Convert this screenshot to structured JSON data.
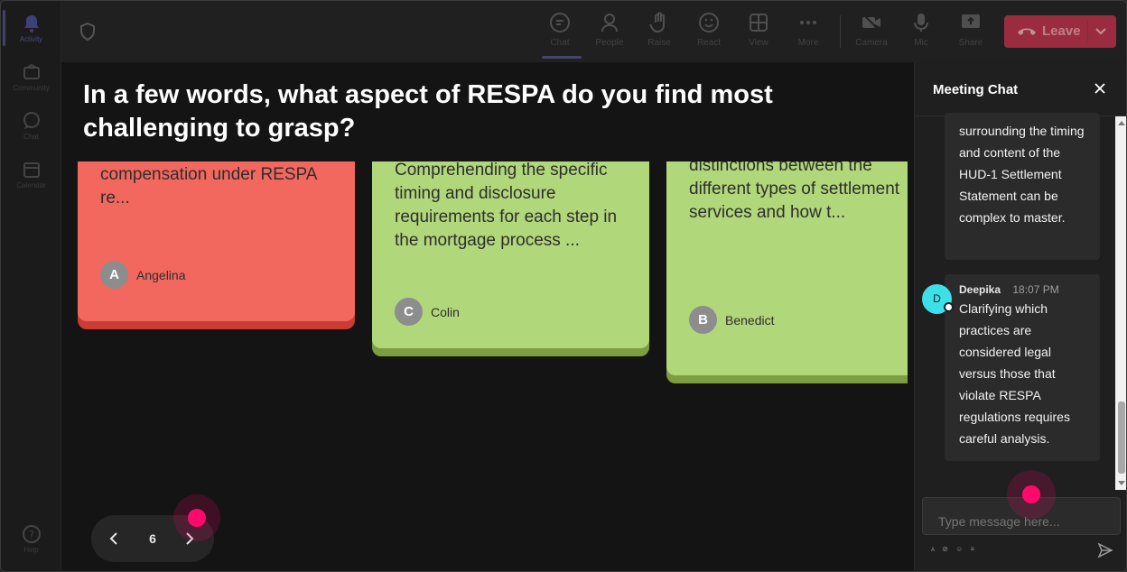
{
  "rail": {
    "items": [
      {
        "label": "Activity"
      },
      {
        "label": "Community"
      },
      {
        "label": "Chat"
      },
      {
        "label": "Calendar"
      },
      {
        "label": "Help"
      }
    ]
  },
  "toolbar": {
    "buttons": [
      {
        "label": "Chat"
      },
      {
        "label": "People"
      },
      {
        "label": "Raise"
      },
      {
        "label": "React"
      },
      {
        "label": "View"
      },
      {
        "label": "More"
      },
      {
        "label": "Camera"
      },
      {
        "label": "Mic"
      },
      {
        "label": "Share"
      }
    ],
    "leave_label": "Leave"
  },
  "question": "In a few words, what aspect of RESPA do you find most challenging to grasp?",
  "cards": [
    {
      "text": "compensation under RESPA re...",
      "initial": "A",
      "author": "Angelina",
      "color": "#f2685f",
      "shadow": "#c93d35"
    },
    {
      "text": "Comprehending the specific timing and disclosure requirements for each step in the mortgage process ...",
      "initial": "C",
      "author": "Colin",
      "color": "#b1d77b",
      "shadow": "#7c9e43"
    },
    {
      "text": "Understanding the detailed distinctions between the different types of settlement services and how t...",
      "initial": "B",
      "author": "Benedict",
      "color": "#b1d77b",
      "shadow": "#7c9e43"
    }
  ],
  "pager": {
    "page": "6"
  },
  "chat": {
    "title": "Meeting Chat",
    "messages": [
      {
        "text": "surrounding the timing and content of the HUD-1 Settlement Statement can be complex to master."
      },
      {
        "sender": "Deepika",
        "time": "18:07 PM",
        "avatar_initial": "D",
        "text": "Clarifying which practices are considered legal versus those that violate RESPA regulations requires careful analysis."
      }
    ],
    "input_placeholder": "Type message here...",
    "format_icons": "ᴀ ⊘ ☺ ≡"
  },
  "colors": {
    "accent": "#6264a7",
    "leave": "#c4314b",
    "marker": "#ff0a6c",
    "avatar_deepika": "#3de0e8"
  }
}
